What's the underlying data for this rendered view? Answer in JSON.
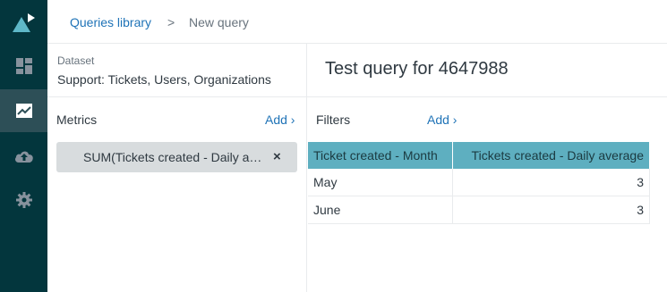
{
  "nav": {
    "items": [
      {
        "icon": "logo-icon"
      },
      {
        "icon": "dashboard-icon"
      },
      {
        "icon": "chart-line-icon",
        "active": true
      },
      {
        "icon": "cloud-upload-icon"
      },
      {
        "icon": "gear-icon"
      }
    ],
    "colors": {
      "background": "#03363d",
      "active": "#2d4f57",
      "logo": "#5eb8c8"
    }
  },
  "breadcrumb": {
    "parent": "Queries library",
    "separator": ">",
    "current": "New query"
  },
  "dataset": {
    "label": "Dataset",
    "value": "Support: Tickets, Users, Organizations"
  },
  "query": {
    "title": "Test query for 4647988"
  },
  "metrics": {
    "label": "Metrics",
    "add_label": "Add ›",
    "items": [
      {
        "text": "SUM(Tickets created - Daily average)",
        "remove": "×"
      }
    ]
  },
  "filters": {
    "label": "Filters",
    "add_label": "Add ›"
  },
  "result": {
    "columns": [
      "Ticket created - Month",
      "Tickets created - Daily average"
    ],
    "rows": [
      [
        "May",
        "3"
      ],
      [
        "June",
        "3"
      ]
    ],
    "header_color": "#5eafc0"
  }
}
